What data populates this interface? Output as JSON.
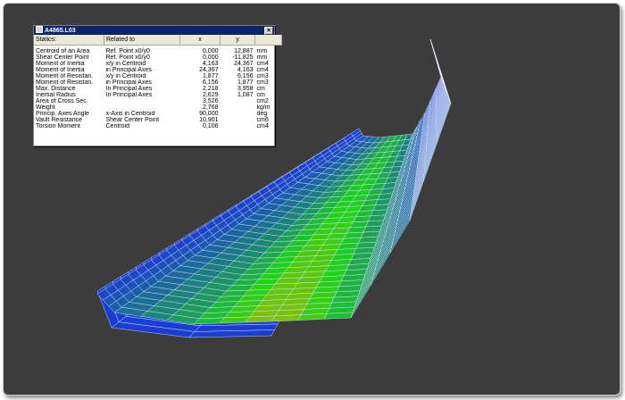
{
  "window": {
    "title": "A4865.L03",
    "close_glyph": "×"
  },
  "table": {
    "headers": [
      "Statics:",
      "Related to",
      "x",
      "y",
      ""
    ],
    "rows": [
      [
        "Centroid of an Area",
        "Ref. Point x0/y0",
        "0,000",
        "12,887",
        "mm"
      ],
      [
        "Shear Center Point",
        "Ref. Point x0/y0",
        "0,000",
        "-11,825",
        "mm"
      ],
      [
        "Moment of Inertia",
        "x/y in Centroid",
        "4,163",
        "24,367",
        "cm4"
      ],
      [
        "Moment of Inertia",
        "in Principal Axes",
        "24,367",
        "4,163",
        "cm4"
      ],
      [
        "Moment of Resistan.",
        "x/y in Centroid",
        "1,877",
        "6,156",
        "cm3"
      ],
      [
        "Moment of Resistan.",
        "in Principal Axes",
        "6,156",
        "1,877",
        "cm3"
      ],
      [
        "Max. Distance",
        "In Principal Axes",
        "2,218",
        "3,958",
        "cm"
      ],
      [
        "Inertial Radius",
        "In Principal Axes",
        "2,629",
        "1,087",
        "cm"
      ],
      [
        "Area of Cross Sec.",
        "",
        "3,526",
        "",
        "cm2"
      ],
      [
        "Weight",
        "",
        "2,768",
        "",
        "kg/m"
      ],
      [
        "Princip. Axes Angle",
        "x-Axis in Centroid",
        "90,000",
        "",
        "deg"
      ],
      [
        "Vault Resistance",
        "Shear Center Point",
        "10,901",
        "",
        "cm6"
      ],
      [
        "Torsion Moment",
        "Centroid",
        "0,106",
        "",
        "cm4"
      ]
    ]
  },
  "colors": {
    "background": "#3c3c3c",
    "mesh_low": "#1a2ee6",
    "mesh_mid": "#1fd31a",
    "mesh_high": "#c8b400",
    "grid_line": "#e6ecff"
  }
}
